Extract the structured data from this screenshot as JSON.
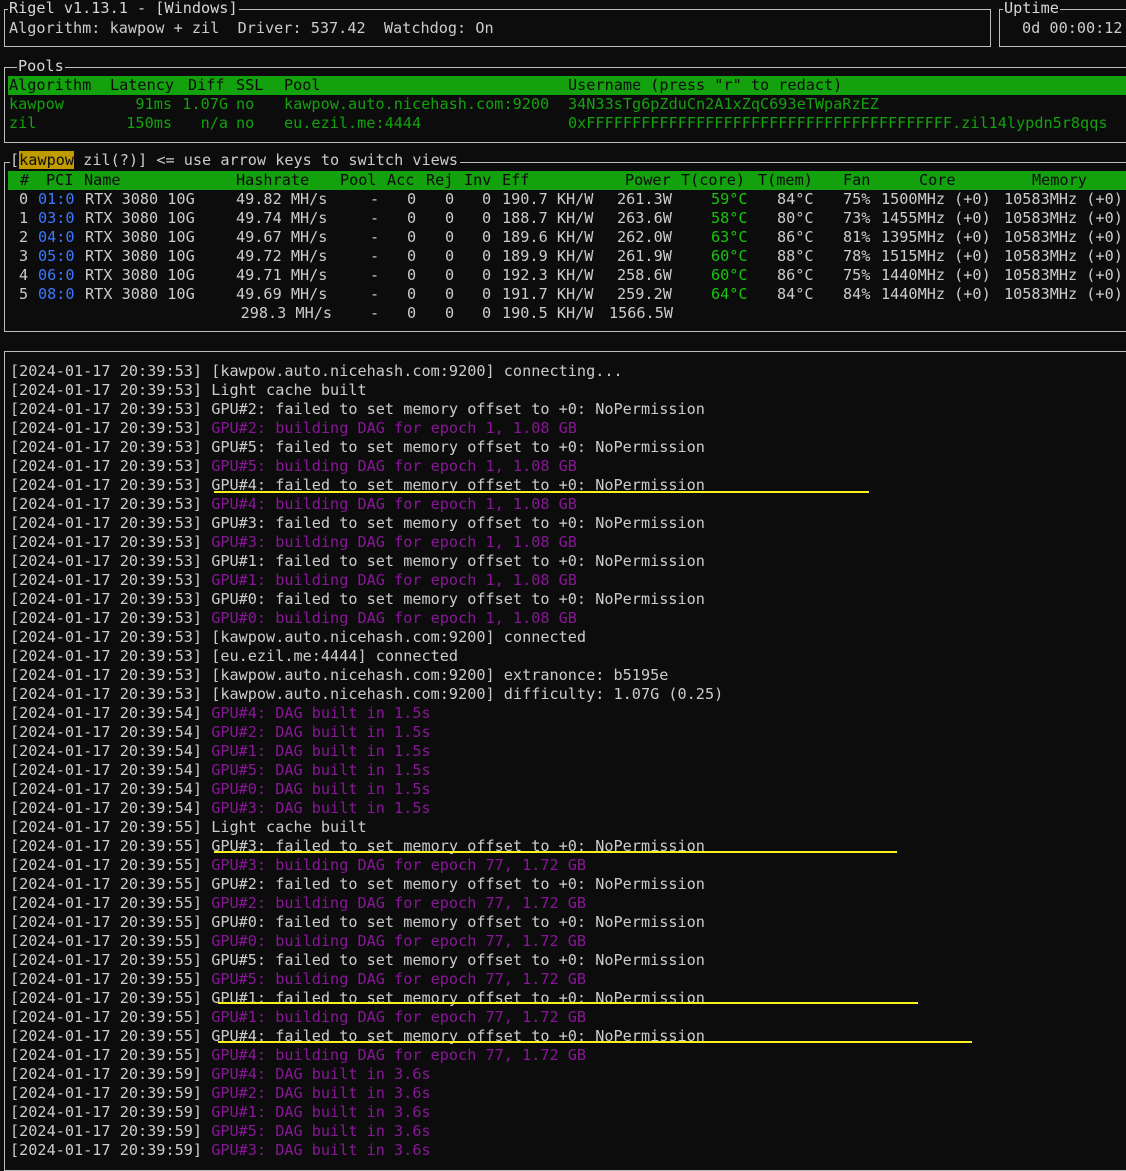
{
  "header": {
    "title": "Rigel v1.13.1 - [Windows]",
    "info": "Algorithm: kawpow + zil  Driver: 537.42  Watchdog: On",
    "uptime_label": "Uptime",
    "uptime_value": "0d 00:00:12"
  },
  "pools": {
    "label": "Pools",
    "columns": [
      "Algorithm",
      "Latency",
      "Diff",
      "SSL",
      "Pool",
      "Username (press \"r\" to redact)"
    ],
    "rows": [
      {
        "algorithm": "kawpow",
        "latency": "91ms",
        "diff": "1.07G",
        "ssl": "no",
        "pool": "kawpow.auto.nicehash.com:9200",
        "username": "34N33sTg6pZduCn2A1xZqC693eTWpaRzEZ"
      },
      {
        "algorithm": "zil",
        "latency": "150ms",
        "diff": "n/a",
        "ssl": "no",
        "pool": "eu.ezil.me:4444",
        "username": "0xFFFFFFFFFFFFFFFFFFFFFFFFFFFFFFFFFFFFFFFF.zil14lypdn5r8qqs"
      }
    ]
  },
  "tabs": {
    "open_bracket": "[",
    "active": "kawpow",
    "inactive": " zil(?)]",
    "hint": " <= use arrow keys to switch views"
  },
  "gpus": {
    "columns": [
      "#",
      "PCI",
      "Name",
      "Hashrate",
      "Pool",
      "Acc",
      "Rej",
      "Inv",
      "Eff",
      "Power",
      "T(core)",
      "T(mem)",
      "Fan",
      "Core",
      "Memory"
    ],
    "rows": [
      {
        "id": "0",
        "pci": "01:0",
        "name": "RTX 3080 10G",
        "hashrate": "49.82 MH/s",
        "pool": "-",
        "acc": "0",
        "rej": "0",
        "inv": "0",
        "eff": "190.7 KH/W",
        "power": "261.3W",
        "tcore": "59°C",
        "tmem": "84°C",
        "fan": "75%",
        "core": "1500MHz (+0)",
        "memory": "10583MHz (+0)"
      },
      {
        "id": "1",
        "pci": "03:0",
        "name": "RTX 3080 10G",
        "hashrate": "49.74 MH/s",
        "pool": "-",
        "acc": "0",
        "rej": "0",
        "inv": "0",
        "eff": "188.7 KH/W",
        "power": "263.6W",
        "tcore": "58°C",
        "tmem": "80°C",
        "fan": "73%",
        "core": "1455MHz (+0)",
        "memory": "10583MHz (+0)"
      },
      {
        "id": "2",
        "pci": "04:0",
        "name": "RTX 3080 10G",
        "hashrate": "49.67 MH/s",
        "pool": "-",
        "acc": "0",
        "rej": "0",
        "inv": "0",
        "eff": "189.6 KH/W",
        "power": "262.0W",
        "tcore": "63°C",
        "tmem": "86°C",
        "fan": "81%",
        "core": "1395MHz (+0)",
        "memory": "10583MHz (+0)"
      },
      {
        "id": "3",
        "pci": "05:0",
        "name": "RTX 3080 10G",
        "hashrate": "49.72 MH/s",
        "pool": "-",
        "acc": "0",
        "rej": "0",
        "inv": "0",
        "eff": "189.9 KH/W",
        "power": "261.9W",
        "tcore": "60°C",
        "tmem": "88°C",
        "fan": "78%",
        "core": "1515MHz (+0)",
        "memory": "10583MHz (+0)"
      },
      {
        "id": "4",
        "pci": "06:0",
        "name": "RTX 3080 10G",
        "hashrate": "49.71 MH/s",
        "pool": "-",
        "acc": "0",
        "rej": "0",
        "inv": "0",
        "eff": "192.3 KH/W",
        "power": "258.6W",
        "tcore": "60°C",
        "tmem": "86°C",
        "fan": "75%",
        "core": "1440MHz (+0)",
        "memory": "10583MHz (+0)"
      },
      {
        "id": "5",
        "pci": "08:0",
        "name": "RTX 3080 10G",
        "hashrate": "49.69 MH/s",
        "pool": "-",
        "acc": "0",
        "rej": "0",
        "inv": "0",
        "eff": "191.7 KH/W",
        "power": "259.2W",
        "tcore": "64°C",
        "tmem": "84°C",
        "fan": "84%",
        "core": "1440MHz (+0)",
        "memory": "10583MHz (+0)"
      }
    ],
    "total": {
      "hashrate": "298.3 MH/s",
      "pool": "-",
      "acc": "0",
      "rej": "0",
      "inv": "0",
      "eff": "190.5 KH/W",
      "power": "1566.5W"
    }
  },
  "log": {
    "colors": {
      "default": "#cccccc",
      "purple": "#881798",
      "highlight": "#f9f11f"
    },
    "lines": [
      {
        "ts": "[2024-01-17 20:39:53]",
        "msg": "[kawpow.auto.nicehash.com:9200] connecting...",
        "purple": false
      },
      {
        "ts": "[2024-01-17 20:39:53]",
        "msg": "Light cache built",
        "purple": false
      },
      {
        "ts": "[2024-01-17 20:39:53]",
        "msg": "GPU#2: failed to set memory offset to +0: NoPermission",
        "purple": false
      },
      {
        "ts": "[2024-01-17 20:39:53]",
        "msg": "GPU#2: building DAG for epoch 1, 1.08 GB",
        "purple": true
      },
      {
        "ts": "[2024-01-17 20:39:53]",
        "msg": "GPU#5: failed to set memory offset to +0: NoPermission",
        "purple": false
      },
      {
        "ts": "[2024-01-17 20:39:53]",
        "msg": "GPU#5: building DAG for epoch 1, 1.08 GB",
        "purple": true
      },
      {
        "ts": "[2024-01-17 20:39:53]",
        "msg": "GPU#4: failed to set memory offset to +0: NoPermission",
        "purple": false
      },
      {
        "ts": "[2024-01-17 20:39:53]",
        "msg": "GPU#4: building DAG for epoch 1, 1.08 GB",
        "purple": true
      },
      {
        "ts": "[2024-01-17 20:39:53]",
        "msg": "GPU#3: failed to set memory offset to +0: NoPermission",
        "purple": false
      },
      {
        "ts": "[2024-01-17 20:39:53]",
        "msg": "GPU#3: building DAG for epoch 1, 1.08 GB",
        "purple": true
      },
      {
        "ts": "[2024-01-17 20:39:53]",
        "msg": "GPU#1: failed to set memory offset to +0: NoPermission",
        "purple": false
      },
      {
        "ts": "[2024-01-17 20:39:53]",
        "msg": "GPU#1: building DAG for epoch 1, 1.08 GB",
        "purple": true
      },
      {
        "ts": "[2024-01-17 20:39:53]",
        "msg": "GPU#0: failed to set memory offset to +0: NoPermission",
        "purple": false
      },
      {
        "ts": "[2024-01-17 20:39:53]",
        "msg": "GPU#0: building DAG for epoch 1, 1.08 GB",
        "purple": true
      },
      {
        "ts": "[2024-01-17 20:39:53]",
        "msg": "[kawpow.auto.nicehash.com:9200] connected",
        "purple": false
      },
      {
        "ts": "[2024-01-17 20:39:53]",
        "msg": "[eu.ezil.me:4444] connected",
        "purple": false
      },
      {
        "ts": "[2024-01-17 20:39:53]",
        "msg": "[kawpow.auto.nicehash.com:9200] extranonce: b5195e",
        "purple": false
      },
      {
        "ts": "[2024-01-17 20:39:53]",
        "msg": "[kawpow.auto.nicehash.com:9200] difficulty: 1.07G (0.25)",
        "purple": false
      },
      {
        "ts": "[2024-01-17 20:39:54]",
        "msg": "GPU#4: DAG built in 1.5s",
        "purple": true
      },
      {
        "ts": "[2024-01-17 20:39:54]",
        "msg": "GPU#2: DAG built in 1.5s",
        "purple": true
      },
      {
        "ts": "[2024-01-17 20:39:54]",
        "msg": "GPU#1: DAG built in 1.5s",
        "purple": true
      },
      {
        "ts": "[2024-01-17 20:39:54]",
        "msg": "GPU#5: DAG built in 1.5s",
        "purple": true
      },
      {
        "ts": "[2024-01-17 20:39:54]",
        "msg": "GPU#0: DAG built in 1.5s",
        "purple": true
      },
      {
        "ts": "[2024-01-17 20:39:54]",
        "msg": "GPU#3: DAG built in 1.5s",
        "purple": true
      },
      {
        "ts": "[2024-01-17 20:39:55]",
        "msg": "Light cache built",
        "purple": false
      },
      {
        "ts": "[2024-01-17 20:39:55]",
        "msg": "GPU#3: failed to set memory offset to +0: NoPermission",
        "purple": false
      },
      {
        "ts": "[2024-01-17 20:39:55]",
        "msg": "GPU#3: building DAG for epoch 77, 1.72 GB",
        "purple": true
      },
      {
        "ts": "[2024-01-17 20:39:55]",
        "msg": "GPU#2: failed to set memory offset to +0: NoPermission",
        "purple": false
      },
      {
        "ts": "[2024-01-17 20:39:55]",
        "msg": "GPU#2: building DAG for epoch 77, 1.72 GB",
        "purple": true
      },
      {
        "ts": "[2024-01-17 20:39:55]",
        "msg": "GPU#0: failed to set memory offset to +0: NoPermission",
        "purple": false
      },
      {
        "ts": "[2024-01-17 20:39:55]",
        "msg": "GPU#0: building DAG for epoch 77, 1.72 GB",
        "purple": true
      },
      {
        "ts": "[2024-01-17 20:39:55]",
        "msg": "GPU#5: failed to set memory offset to +0: NoPermission",
        "purple": false
      },
      {
        "ts": "[2024-01-17 20:39:55]",
        "msg": "GPU#5: building DAG for epoch 77, 1.72 GB",
        "purple": true
      },
      {
        "ts": "[2024-01-17 20:39:55]",
        "msg": "GPU#1: failed to set memory offset to +0: NoPermission",
        "purple": false
      },
      {
        "ts": "[2024-01-17 20:39:55]",
        "msg": "GPU#1: building DAG for epoch 77, 1.72 GB",
        "purple": true
      },
      {
        "ts": "[2024-01-17 20:39:55]",
        "msg": "GPU#4: failed to set memory offset to +0: NoPermission",
        "purple": false
      },
      {
        "ts": "[2024-01-17 20:39:55]",
        "msg": "GPU#4: building DAG for epoch 77, 1.72 GB",
        "purple": true
      },
      {
        "ts": "[2024-01-17 20:39:59]",
        "msg": "GPU#4: DAG built in 3.6s",
        "purple": true
      },
      {
        "ts": "[2024-01-17 20:39:59]",
        "msg": "GPU#2: DAG built in 3.6s",
        "purple": true
      },
      {
        "ts": "[2024-01-17 20:39:59]",
        "msg": "GPU#1: DAG built in 3.6s",
        "purple": true
      },
      {
        "ts": "[2024-01-17 20:39:59]",
        "msg": "GPU#5: DAG built in 3.6s",
        "purple": true
      },
      {
        "ts": "[2024-01-17 20:39:59]",
        "msg": "GPU#3: DAG built in 3.6s",
        "purple": true
      }
    ]
  }
}
